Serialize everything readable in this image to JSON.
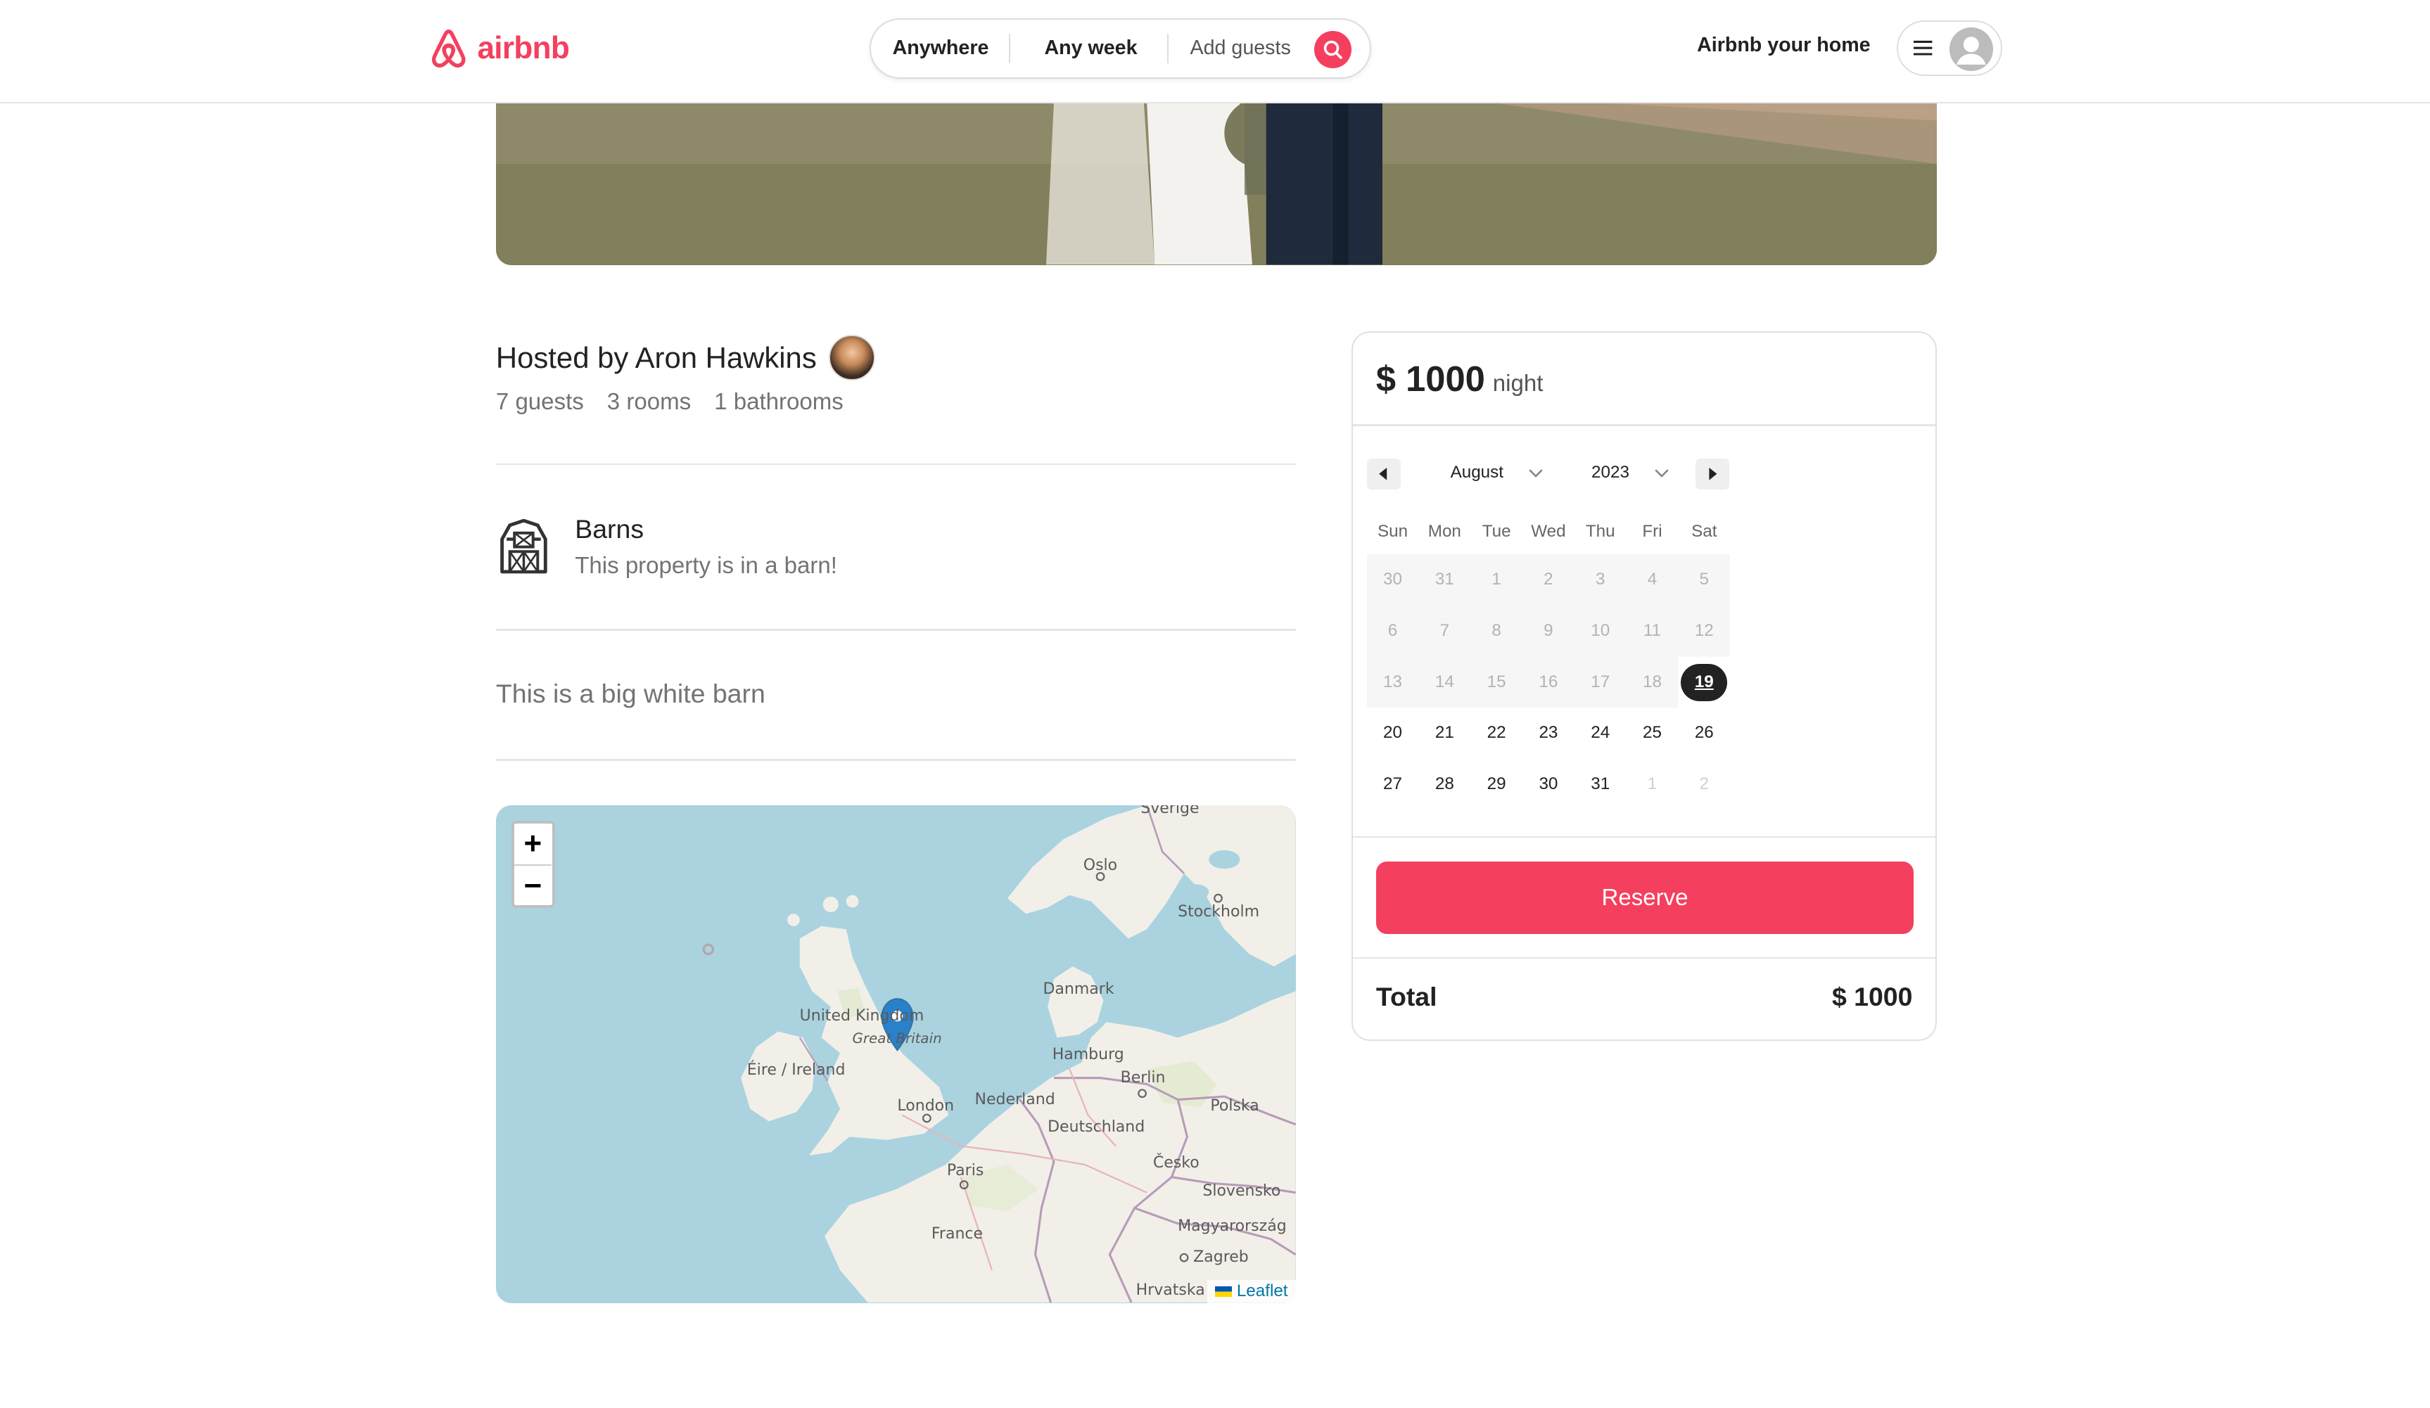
{
  "header": {
    "logo_text": "airbnb",
    "search": {
      "anywhere": "Anywhere",
      "any_week": "Any week",
      "add_guests": "Add guests"
    },
    "host_link": "Airbnb your home"
  },
  "listing": {
    "hosted_by": "Hosted by Aron Hawkins",
    "stats": {
      "guests": "7 guests",
      "rooms": "3 rooms",
      "bathrooms": "1 bathrooms"
    },
    "category": {
      "label": "Barns",
      "description": "This property is in a barn!"
    },
    "description": "This is a big white barn"
  },
  "map": {
    "zoom_in": "+",
    "zoom_out": "−",
    "labels": {
      "sverige": "Sverige",
      "oslo": "Oslo",
      "stockholm": "Stockholm",
      "danmark": "Danmark",
      "united_kingdom": "United Kingdom",
      "great_britain": "Great Britain",
      "eire": "Éire / Ireland",
      "hamburg": "Hamburg",
      "berlin": "Berlin",
      "london": "London",
      "nederland": "Nederland",
      "deutschland": "Deutschland",
      "polska": "Polska",
      "cesko": "Česko",
      "paris": "Paris",
      "slovensko": "Slovensko",
      "france": "France",
      "magyarorszag": "Magyarország",
      "zagreb": "Zagreb",
      "hrvatska": "Hrvatska"
    },
    "attribution": "Leaflet"
  },
  "booking": {
    "price": "$ 1000",
    "price_unit": "night",
    "calendar": {
      "month": "August",
      "year": "2023",
      "weekdays": [
        "Sun",
        "Mon",
        "Tue",
        "Wed",
        "Thu",
        "Fri",
        "Sat"
      ],
      "weeks": [
        [
          "30",
          "31",
          "1",
          "2",
          "3",
          "4",
          "5"
        ],
        [
          "6",
          "7",
          "8",
          "9",
          "10",
          "11",
          "12"
        ],
        [
          "13",
          "14",
          "15",
          "16",
          "17",
          "18",
          "19"
        ],
        [
          "20",
          "21",
          "22",
          "23",
          "24",
          "25",
          "26"
        ],
        [
          "27",
          "28",
          "29",
          "30",
          "31",
          "1",
          "2"
        ]
      ],
      "selected_day": "19"
    },
    "reserve_label": "Reserve",
    "total_label": "Total",
    "total_value": "$ 1000"
  },
  "colors": {
    "brand": "#F43F5E",
    "map_water": "#aad3df",
    "map_land": "#f2efe9"
  }
}
